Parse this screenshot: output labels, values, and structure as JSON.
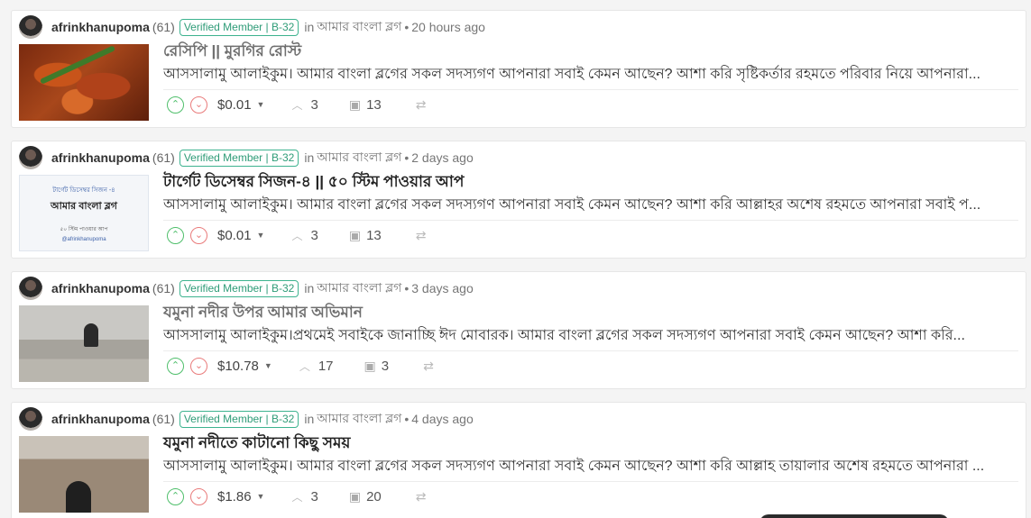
{
  "posts": [
    {
      "author": "afrinkhanupoma",
      "reputation": "(61)",
      "badge": "Verified Member | B-32",
      "in_label": "in",
      "community": "আমার বাংলা ব্লগ",
      "separator": "•",
      "time": "20 hours ago",
      "title": "রেসিপি || মুরগির রোস্ট",
      "summary": "আসসালামু আলাইকুম। আমার বাংলা ব্লগের সকল সদস্যগণ আপনারা সবাই কেমন আছেন? আশা করি সৃষ্টিকর্তার রহমতে পরিবার নিয়ে আপনারা...",
      "payout": "$0.01",
      "votes": "3",
      "comments": "13"
    },
    {
      "author": "afrinkhanupoma",
      "reputation": "(61)",
      "badge": "Verified Member | B-32",
      "in_label": "in",
      "community": "আমার বাংলা ব্লগ",
      "separator": "•",
      "time": "2 days ago",
      "title": "টার্গেট ডিসেম্বর সিজন-৪ || ৫০ স্টিম পাওয়ার আপ",
      "summary": "আসসালামু আলাইকুম। আমার বাংলা ব্লগের সকল সদস্যগণ আপনারা সবাই কেমন আছেন? আশা করি আল্লাহর অশেষ রহমতে আপনারা সবাই প...",
      "payout": "$0.01",
      "votes": "3",
      "comments": "13",
      "thumb_text": {
        "line1": "টার্গেট ডিসেম্বর সিজন -৪",
        "line2": "আমার বাংলা ব্লগ",
        "line3": "৫০ স্টিম পাওয়ার আপ",
        "line4": "@afrinkhanupoma"
      }
    },
    {
      "author": "afrinkhanupoma",
      "reputation": "(61)",
      "badge": "Verified Member | B-32",
      "in_label": "in",
      "community": "আমার বাংলা ব্লগ",
      "separator": "•",
      "time": "3 days ago",
      "title": "যমুনা নদীর উপর আমার অভিমান",
      "summary": "আসসালামু আলাইকুম।প্রথমেই সবাইকে জানাচ্ছি ঈদ মোবারক। আমার বাংলা ব্লগের সকল সদস্যগণ আপনারা সবাই কেমন আছেন? আশা করি...",
      "payout": "$10.78",
      "votes": "17",
      "comments": "3"
    },
    {
      "author": "afrinkhanupoma",
      "reputation": "(61)",
      "badge": "Verified Member | B-32",
      "in_label": "in",
      "community": "আমার বাংলা ব্লগ",
      "separator": "•",
      "time": "4 days ago",
      "title": "যমুনা নদীতে কাটানো কিছু সময়",
      "summary": "আসসালামু আলাইকুম। আমার বাংলা ব্লগের সকল সদস্যগণ আপনারা সবাই কেমন আছেন? আশা করি আল্লাহ তায়ালার অশেষ রহমতে আপনারা ...",
      "payout": "$1.86",
      "votes": "3",
      "comments": "20"
    }
  ],
  "icons": {
    "upvote": "⌃",
    "downvote": "⌄",
    "caret": "▼",
    "vote_count": "︿",
    "comment": "▣",
    "reblog": "⇄"
  },
  "colors": {
    "upvote": "#4fbf6b",
    "downvote": "#e97b7b",
    "badge": "#3db38f"
  }
}
